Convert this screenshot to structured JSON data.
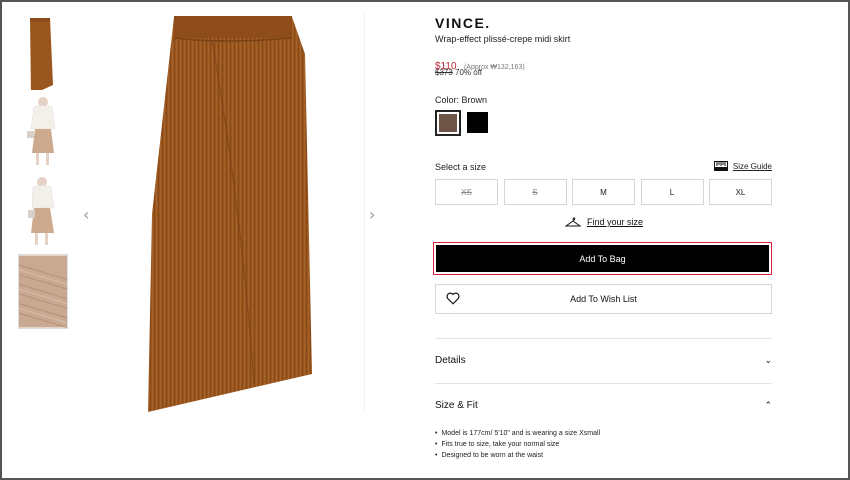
{
  "nav": {
    "prev_arrow": "‹",
    "next_arrow": "›"
  },
  "product": {
    "brand": "VINCE.",
    "name": "Wrap-effect plissé-crepe midi skirt",
    "price": "$110",
    "approx": "(Approx ₩132,163)",
    "old_price": "$373",
    "discount": "70% off",
    "color_label": "Color: Brown",
    "colors": [
      {
        "name": "Brown",
        "hex": "#6e5446",
        "selected": true
      },
      {
        "name": "Black",
        "hex": "#000000",
        "selected": false
      }
    ]
  },
  "sizes": {
    "label": "Select a size",
    "guide": "Size Guide",
    "options": [
      {
        "label": "XS",
        "available": false
      },
      {
        "label": "S",
        "available": false
      },
      {
        "label": "M",
        "available": true
      },
      {
        "label": "L",
        "available": true
      },
      {
        "label": "XL",
        "available": true
      }
    ],
    "find_size": "Find your size"
  },
  "actions": {
    "add_to_bag": "Add To Bag",
    "wish_list": "Add To Wish List"
  },
  "accordion": {
    "details": {
      "label": "Details",
      "chevron": "⌄"
    },
    "size_fit": {
      "label": "Size & Fit",
      "chevron": "⌃",
      "bullets": [
        "Model is 177cm/ 5'10\" and is wearing a size Xsmall",
        "Fits true to size, take your normal size",
        "Designed to be worn at the waist"
      ]
    }
  },
  "colors": {
    "accent_red": "#c0263b",
    "focus_outline": "#e0203a",
    "skirt": "#9a561f"
  }
}
